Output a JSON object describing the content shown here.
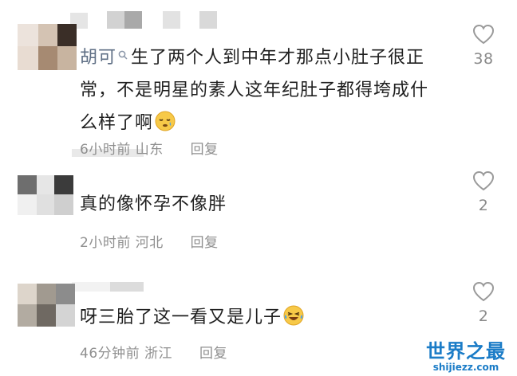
{
  "comments": [
    {
      "username": "胡可",
      "text": "生了两个人到中年才那点小肚子很正常，不是明星的素人这年纪肚子都得垮成什么样了啊",
      "text_line1": "生了两个人到中年才那点小肚子很正",
      "text_line2": "常，不是明星的素人这年纪肚子都得垮成什",
      "text_line3": "么样了啊",
      "emoji": "sleepy-face-emoji",
      "time": "6小时前",
      "location": "山东",
      "reply_label": "回复",
      "likes": "38"
    },
    {
      "text": "真的像怀孕不像胖",
      "time": "2小时前",
      "location": "河北",
      "reply_label": "回复",
      "likes": "2"
    },
    {
      "text": "呀三胎了这一看又是儿子",
      "emoji": "laughing-tears-emoji",
      "time": "46分钟前",
      "location": "浙江",
      "reply_label": "回复",
      "likes": "2"
    }
  ],
  "watermark": {
    "title": "世界之最",
    "url": "shijiezz.com"
  },
  "colors": {
    "username": "#5f6f85",
    "meta": "#8f8f8f",
    "like_icon": "#9a9a9a",
    "watermark": "#1b7cc7"
  }
}
